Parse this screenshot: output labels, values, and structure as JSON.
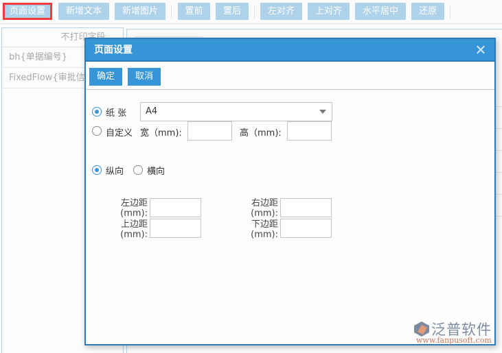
{
  "toolbar": {
    "buttons": [
      {
        "label": "页面设置",
        "active": true
      },
      {
        "label": "新增文本"
      },
      {
        "label": "新增图片"
      },
      {
        "label": "置前"
      },
      {
        "label": "置后"
      },
      {
        "label": "左对齐"
      },
      {
        "label": "上对齐"
      },
      {
        "label": "水平居中"
      },
      {
        "label": "还原"
      }
    ]
  },
  "left_panel": {
    "header": "不打印字段",
    "rows": [
      "bh{单据编号}",
      "FixedFlow{审批信息}"
    ]
  },
  "dialog": {
    "title": "页面设置",
    "close_icon": "close-icon",
    "confirm_label": "确定",
    "cancel_label": "取消",
    "paper": {
      "paper_radio_label": "纸 张",
      "paper_selected": true,
      "paper_size_value": "A4",
      "custom_radio_label": "自定义",
      "custom_selected": false,
      "width_label": "宽（mm):",
      "width_value": "",
      "height_label": "高（mm):",
      "height_value": ""
    },
    "orientation": {
      "portrait_label": "纵向",
      "portrait_selected": true,
      "landscape_label": "横向",
      "landscape_selected": false
    },
    "margins": {
      "left_label_1": "左边距",
      "left_label_2": "(mm):",
      "left_value": "",
      "right_label_1": "右边距",
      "right_label_2": "(mm):",
      "right_value": "",
      "top_label_1": "上边距",
      "top_label_2": "(mm):",
      "top_value": "",
      "bottom_label_1": "下边距",
      "bottom_label_2": "(mm):",
      "bottom_value": ""
    }
  },
  "watermark": {
    "brand": "泛普软件",
    "url": "www.fanpusoft.com"
  },
  "colors": {
    "dialog_header": "#3695d7",
    "toolbar_button": "#afd2eb",
    "active_outline": "#f03c3c"
  }
}
